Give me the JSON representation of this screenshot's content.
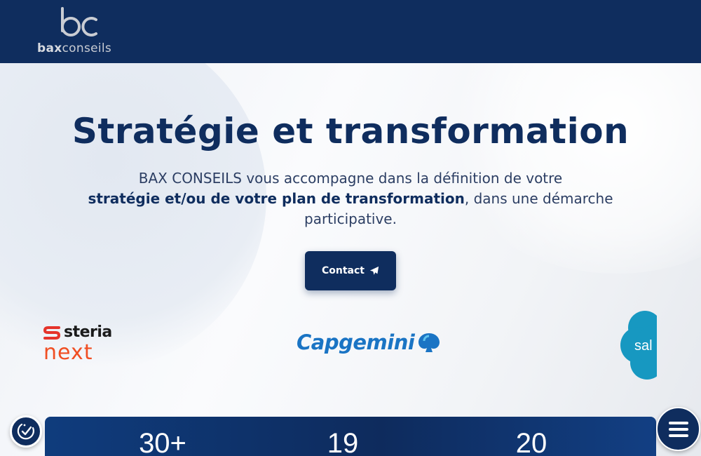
{
  "header": {
    "logo_mark": "bc",
    "logo_text_bold": "bax",
    "logo_text_light": "conseils"
  },
  "hero": {
    "title": "Stratégie et transformation",
    "desc_part1": "BAX CONSEILS vous accompagne dans la définition de votre",
    "desc_bold": "stratégie et/ou de votre plan de transformation",
    "desc_part2": ", dans une démarche participative.",
    "contact_label": "Contact"
  },
  "partners": {
    "steria_top": "steria",
    "steria_bottom": "next",
    "capgemini": "Capgemini",
    "salesforce": "sal"
  },
  "stats": [
    {
      "value": "30+"
    },
    {
      "value": "19"
    },
    {
      "value": "20"
    }
  ],
  "colors": {
    "brand_navy": "#0f2d5e",
    "steria_orange": "#f04e23",
    "capgemini_blue": "#1a74c4",
    "salesforce_blue": "#1798c1"
  },
  "icons": {
    "contact": "paper-plane-icon",
    "accessibility": "accessibility-check-icon",
    "menu": "hamburger-menu-icon"
  }
}
